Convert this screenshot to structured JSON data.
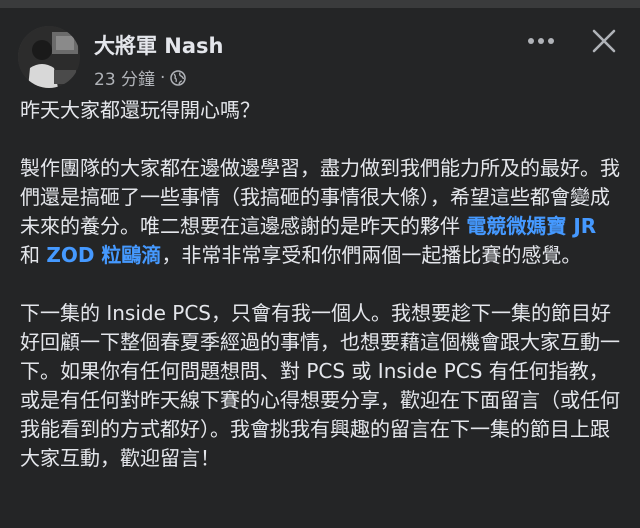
{
  "post": {
    "author": "大將軍 Nash",
    "timestamp": "23 分鐘",
    "separator": "·",
    "privacy_icon": "globe-icon",
    "more_icon": "more-horizontal-icon",
    "close_icon": "close-icon",
    "paragraph1": "昨天大家都還玩得開心嗎？",
    "paragraph2": {
      "text_before": "製作團隊的大家都在邊做邊學習，盡力做到我們能力所及的最好。我們還是搞砸了一些事情（我搞砸的事情很大條），希望這些都會變成未來的養分。唯二想要在這邊感謝的是昨天的夥伴 ",
      "mention1": "電競微媽寶 JR",
      "text_between": " 和 ",
      "mention2": "ZOD 粒鷗滴",
      "text_after": "，非常非常享受和你們兩個一起播比賽的感覺。"
    },
    "paragraph3": "下一集的 Inside PCS，只會有我一個人。我想要趁下一集的節目好好回顧一下整個春夏季經過的事情，也想要藉這個機會跟大家互動一下。如果你有任何問題想問、對 PCS 或 Inside PCS 有任何指教，或是有任何對昨天線下賽的心得想要分享，歡迎在下面留言（或任何我能看到的方式都好）。我會挑我有興趣的留言在下一集的節目上跟大家互動，歡迎留言！"
  },
  "colors": {
    "background": "#242526",
    "text_primary": "#e4e6eb",
    "text_secondary": "#b0b3b8",
    "mention": "#4599ff"
  }
}
